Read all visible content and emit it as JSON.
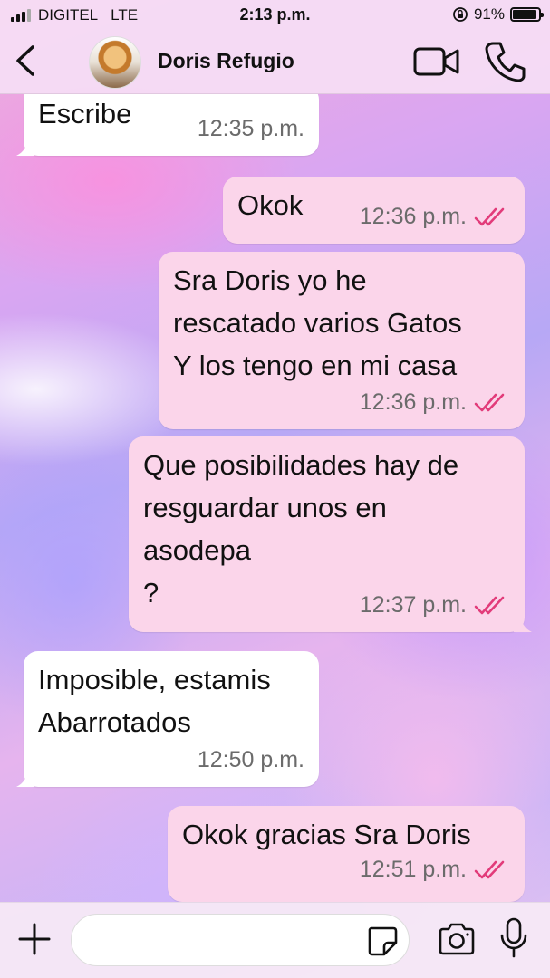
{
  "status_bar": {
    "carrier": "DIGITEL",
    "network": "LTE",
    "time": "2:13 p.m.",
    "battery": "91%",
    "battery_level": 0.91
  },
  "header": {
    "contact_name": "Doris Refugio",
    "icons": [
      "back-chevron-icon",
      "avatar",
      "video-camera-icon",
      "phone-icon"
    ]
  },
  "messages": [
    {
      "direction": "in",
      "text": "Escribe",
      "time": "12:35 p.m."
    },
    {
      "direction": "out",
      "text": "Okok",
      "time": "12:36 p.m.",
      "status": "read"
    },
    {
      "direction": "out",
      "text": "Sra Doris yo he\nrescatado varios Gatos\nY los tengo en mi casa",
      "time": "12:36 p.m.",
      "status": "read"
    },
    {
      "direction": "out",
      "text": "Que posibilidades hay de\nresguardar unos en\nasodepa\n?",
      "time": "12:37 p.m.",
      "status": "read"
    },
    {
      "direction": "in",
      "text": "Imposible, estamis\nAbarrotados",
      "time": "12:50 p.m."
    },
    {
      "direction": "out",
      "text": "Okok gracias Sra Doris",
      "time": "12:51 p.m.",
      "status": "read"
    }
  ],
  "input": {
    "value": "",
    "placeholder": ""
  },
  "colors": {
    "outgoing_bubble": "#fbd5ea",
    "incoming_bubble": "#ffffff",
    "read_ticks": "#e23b7a",
    "header_bg": "#f6dcf4"
  }
}
